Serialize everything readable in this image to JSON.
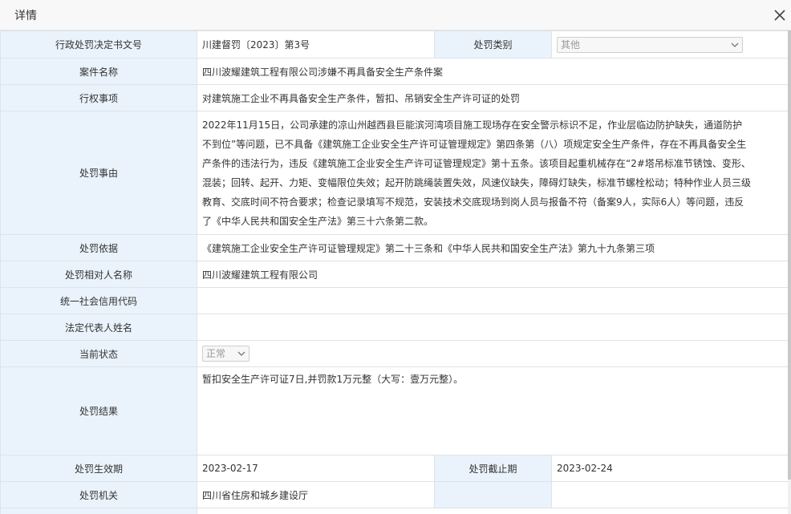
{
  "dialog": {
    "title": "详情"
  },
  "form": {
    "decision_no": {
      "label": "行政处罚决定书文号",
      "value": "川建督罚〔2023〕第3号"
    },
    "penalty_type": {
      "label": "处罚类别",
      "value": "其他"
    },
    "case_name": {
      "label": "案件名称",
      "value": "四川波耀建筑工程有限公司涉嫌不再具备安全生产条件案"
    },
    "power_item": {
      "label": "行权事项",
      "value": "对建筑施工企业不再具备安全生产条件，暂扣、吊销安全生产许可证的处罚"
    },
    "reason": {
      "label": "处罚事由",
      "value": "2022年11月15日，公司承建的凉山州越西县巨能滨河湾项目施工现场存在安全警示标识不足，作业层临边防护缺失，通道防护不到位”等问题，已不具备《建筑施工企业安全生产许可证管理规定》第四条第（八）项规定安全生产条件，存在不再具备安全生产条件的违法行为，违反《建筑施工企业安全生产许可证管理规定》第十五条。该项目起重机械存在“2#塔吊标准节锈蚀、变形、混装；回转、起开、力矩、变幅限位失效；起开防跳绳装置失效，风速仪缺失，障碍灯缺失，标准节螺栓松动；特种作业人员三级教育、交底时间不符合要求；检查记录填写不规范，安装技术交底现场到岗人员与报备不符（备案9人，实际6人）等问题，违反了《中华人民共和国安全生产法》第三十六条第二款。"
    },
    "basis": {
      "label": "处罚依据",
      "value": "《建筑施工企业安全生产许可证管理规定》第二十三条和《中华人民共和国安全生产法》第九十九条第三项"
    },
    "party_name": {
      "label": "处罚相对人名称",
      "value": "四川波耀建筑工程有限公司"
    },
    "credit_code": {
      "label": "统一社会信用代码",
      "value": ""
    },
    "legal_rep": {
      "label": "法定代表人姓名",
      "value": ""
    },
    "status": {
      "label": "当前状态",
      "value": "正常"
    },
    "result": {
      "label": "处罚结果",
      "value": "暂扣安全生产许可证7日,并罚款1万元整（大写：壹万元整）。"
    },
    "effective_date": {
      "label": "处罚生效期",
      "value": "2023-02-17"
    },
    "end_date": {
      "label": "处罚截止期",
      "value": "2023-02-24"
    },
    "authority": {
      "label": "处罚机关",
      "value": "四川省住房和城乡建设厅"
    }
  },
  "icons": {
    "close": "close-icon",
    "dropdown": "chevron-down-icon"
  },
  "colors": {
    "label_bg": "#eaf3fb",
    "border": "#dce3ea",
    "title_bg": "#f8f8f8"
  }
}
